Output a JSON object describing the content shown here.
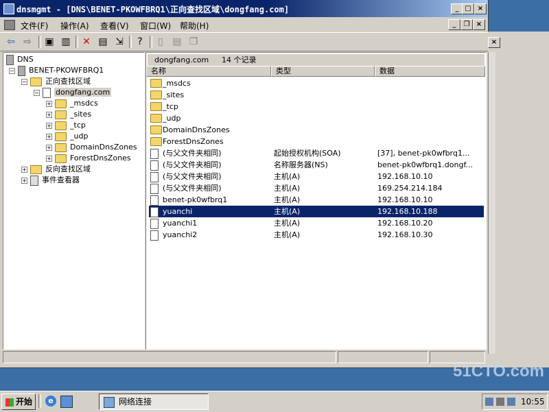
{
  "window": {
    "title": "dnsmgmt - [DNS\\BENET-PKOWFBRQ1\\正向查找区域\\dongfang.com]"
  },
  "menu": [
    "文件(F)",
    "操作(A)",
    "查看(V)",
    "窗口(W)",
    "帮助(H)"
  ],
  "tree": {
    "root": "DNS",
    "server": "BENET-PKOWFBRQ1",
    "forward": "正向查找区域",
    "zone": "dongfang.com",
    "subzones": [
      "_msdcs",
      "_sites",
      "_tcp",
      "_udp",
      "DomainDnsZones",
      "ForestDnsZones"
    ],
    "reverse": "反向查找区域",
    "events": "事件查看器"
  },
  "detail": {
    "zone": "dongfang.com",
    "count": "14 个记录",
    "columns": [
      "名称",
      "类型",
      "数据"
    ],
    "rows": [
      {
        "name": "_msdcs",
        "type": "",
        "data": "",
        "icon": "folder"
      },
      {
        "name": "_sites",
        "type": "",
        "data": "",
        "icon": "folder"
      },
      {
        "name": "_tcp",
        "type": "",
        "data": "",
        "icon": "folder"
      },
      {
        "name": "_udp",
        "type": "",
        "data": "",
        "icon": "folder"
      },
      {
        "name": "DomainDnsZones",
        "type": "",
        "data": "",
        "icon": "folder"
      },
      {
        "name": "ForestDnsZones",
        "type": "",
        "data": "",
        "icon": "folder"
      },
      {
        "name": "(与父文件夹相同)",
        "type": "起始授权机构(SOA)",
        "data": "[37], benet-pk0wfbrq1...",
        "icon": "record"
      },
      {
        "name": "(与父文件夹相同)",
        "type": "名称服务器(NS)",
        "data": "benet-pk0wfbrq1.dongf...",
        "icon": "record"
      },
      {
        "name": "(与父文件夹相同)",
        "type": "主机(A)",
        "data": "192.168.10.10",
        "icon": "record"
      },
      {
        "name": "(与父文件夹相同)",
        "type": "主机(A)",
        "data": "169.254.214.184",
        "icon": "record"
      },
      {
        "name": "benet-pk0wfbrq1",
        "type": "主机(A)",
        "data": "192.168.10.10",
        "icon": "record"
      },
      {
        "name": "yuanchi",
        "type": "主机(A)",
        "data": "192.168.10.188",
        "icon": "record",
        "selected": true
      },
      {
        "name": "yuanchi1",
        "type": "主机(A)",
        "data": "192.168.10.20",
        "icon": "record"
      },
      {
        "name": "yuanchi2",
        "type": "主机(A)",
        "data": "192.168.10.30",
        "icon": "record"
      }
    ]
  },
  "taskbar": {
    "start": "开始",
    "task": "网络连接",
    "clock": "10:55"
  },
  "watermark": "51CTO.com"
}
